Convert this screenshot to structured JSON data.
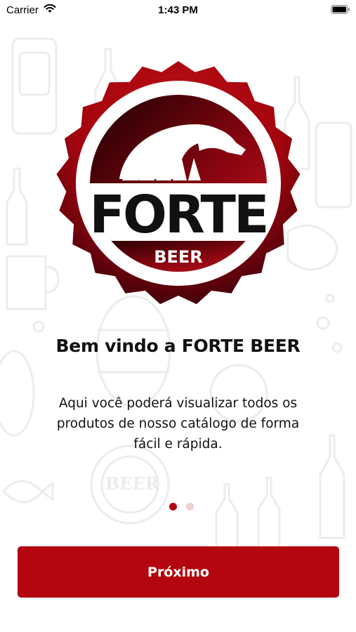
{
  "status_bar": {
    "carrier": "Carrier",
    "time": "1:43 PM"
  },
  "logo": {
    "brand": "FORTE",
    "sub": "BEER",
    "colors": {
      "primary": "#b30610",
      "dark": "#2a0003",
      "text": "#111111"
    }
  },
  "onboarding": {
    "title": "Bem vindo a FORTE BEER",
    "description_lines": [
      "Aqui você poderá visualizar todos os",
      "produtos de nosso catálogo de forma",
      "fácil e rápida."
    ],
    "page_count": 2,
    "active_page": 1
  },
  "actions": {
    "next_label": "Próximo"
  },
  "theme": {
    "accent": "#b30610",
    "dot_inactive": "#f0cfd2",
    "pattern": "#eeeeee"
  },
  "icons": {
    "wifi": "wifi-icon",
    "battery": "battery-icon",
    "logo": "bottle-cap-eagle-logo"
  }
}
